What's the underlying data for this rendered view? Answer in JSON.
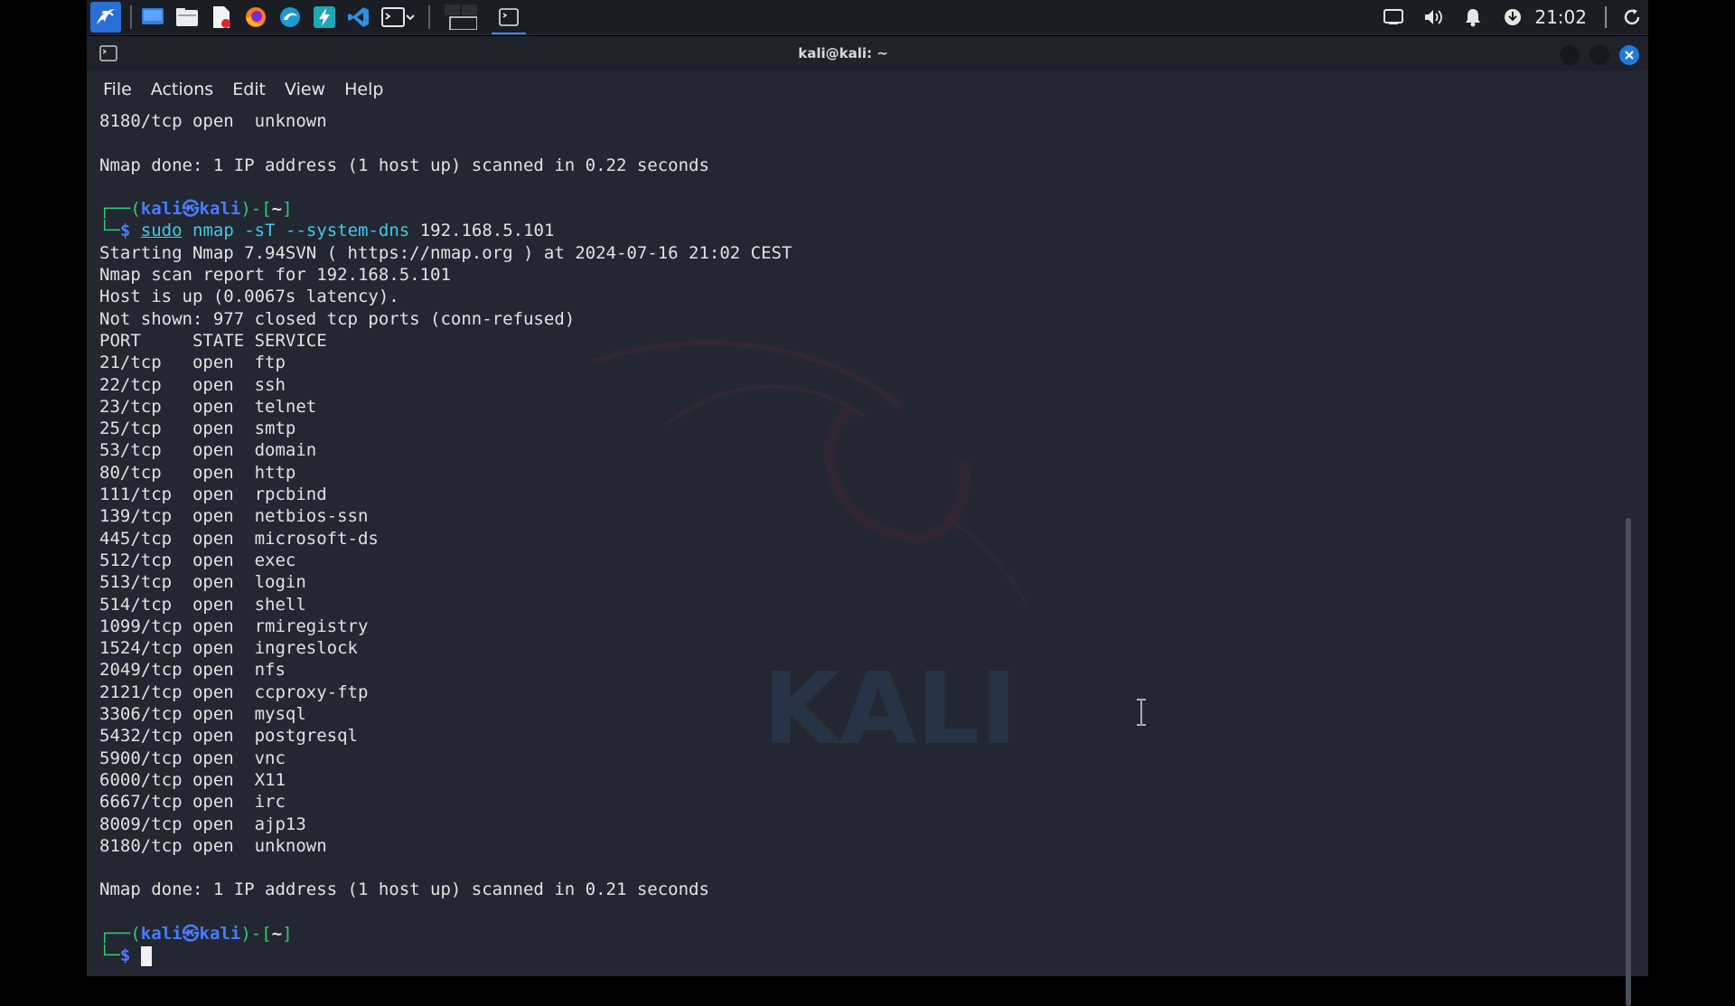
{
  "taskbar": {
    "launchers": [
      {
        "name": "kali-menu-icon"
      },
      {
        "name": "desktop-icon"
      },
      {
        "name": "file-manager-icon"
      },
      {
        "name": "text-editor-icon"
      },
      {
        "name": "firefox-icon"
      },
      {
        "name": "browser-icon"
      },
      {
        "name": "burpsuite-icon"
      },
      {
        "name": "vscode-icon"
      },
      {
        "name": "terminal-icon"
      }
    ],
    "clock": "21:02",
    "tray": [
      "screen-icon",
      "volume-icon",
      "notification-bell-icon",
      "network-icon"
    ]
  },
  "window": {
    "title": "kali@kali: ~",
    "menu": [
      "File",
      "Actions",
      "Edit",
      "View",
      "Help"
    ]
  },
  "terminal": {
    "lines_top": [
      "8180/tcp open  unknown",
      "",
      "Nmap done: 1 IP address (1 host up) scanned in 0.22 seconds",
      ""
    ],
    "prompt": {
      "user": "kali",
      "at": "㉿",
      "host": "kali",
      "dir": "~",
      "dollar": "$"
    },
    "command": {
      "sudo": "sudo",
      "rest": "nmap -sT --system-dns",
      "arg": "192.168.5.101"
    },
    "output": [
      "Starting Nmap 7.94SVN ( https://nmap.org ) at 2024-07-16 21:02 CEST",
      "Nmap scan report for 192.168.5.101",
      "Host is up (0.0067s latency).",
      "Not shown: 977 closed tcp ports (conn-refused)",
      "PORT     STATE SERVICE",
      "21/tcp   open  ftp",
      "22/tcp   open  ssh",
      "23/tcp   open  telnet",
      "25/tcp   open  smtp",
      "53/tcp   open  domain",
      "80/tcp   open  http",
      "111/tcp  open  rpcbind",
      "139/tcp  open  netbios-ssn",
      "445/tcp  open  microsoft-ds",
      "512/tcp  open  exec",
      "513/tcp  open  login",
      "514/tcp  open  shell",
      "1099/tcp open  rmiregistry",
      "1524/tcp open  ingreslock",
      "2049/tcp open  nfs",
      "2121/tcp open  ccproxy-ftp",
      "3306/tcp open  mysql",
      "5432/tcp open  postgresql",
      "5900/tcp open  vnc",
      "6000/tcp open  X11",
      "6667/tcp open  irc",
      "8009/tcp open  ajp13",
      "8180/tcp open  unknown",
      "",
      "Nmap done: 1 IP address (1 host up) scanned in 0.21 seconds",
      ""
    ],
    "watermark": "KALI"
  },
  "colors": {
    "prompt_blue": "#4a7bff",
    "prompt_frame": "#2ecc71",
    "command_cyan": "#42c9e8",
    "accent": "#1f7ae0"
  }
}
